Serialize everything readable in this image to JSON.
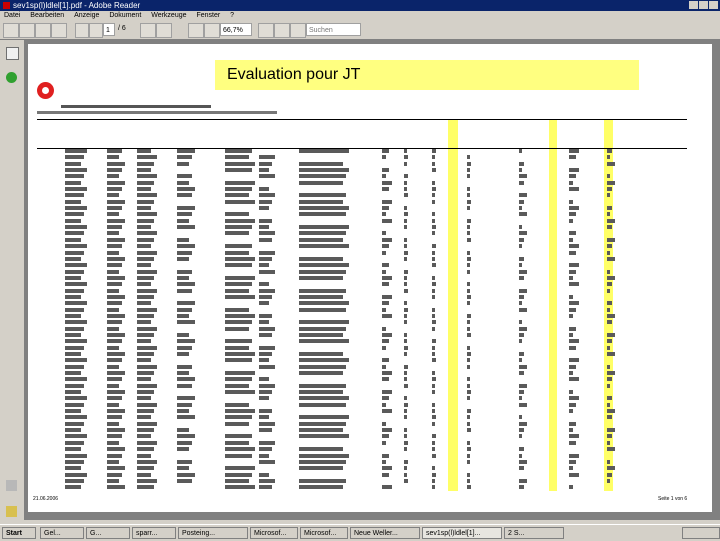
{
  "window": {
    "title": "sev1sp(l)ldlel[1].pdf - Adobe Reader"
  },
  "menu": {
    "items": [
      "Datei",
      "Bearbeiten",
      "Anzeige",
      "Dokument",
      "Werkzeuge",
      "Fenster",
      "?"
    ]
  },
  "toolbar": {
    "page_current": "1",
    "page_total": "/ 6",
    "zoom": "66,7%",
    "search_placeholder": "Suchen"
  },
  "document": {
    "evaluation_label": "Evaluation pour JT",
    "footer_left": "21.06.2006",
    "footer_right": "Seite 1 von 6"
  },
  "taskbar": {
    "start_label": "Start",
    "buttons": [
      "Gel...",
      "G...",
      "sparr...",
      "Posteing...",
      "Microsof...",
      "Microsof...",
      "Neue Weller...",
      "sev1sp(l)ldlel[1]...",
      "2 S..."
    ]
  }
}
